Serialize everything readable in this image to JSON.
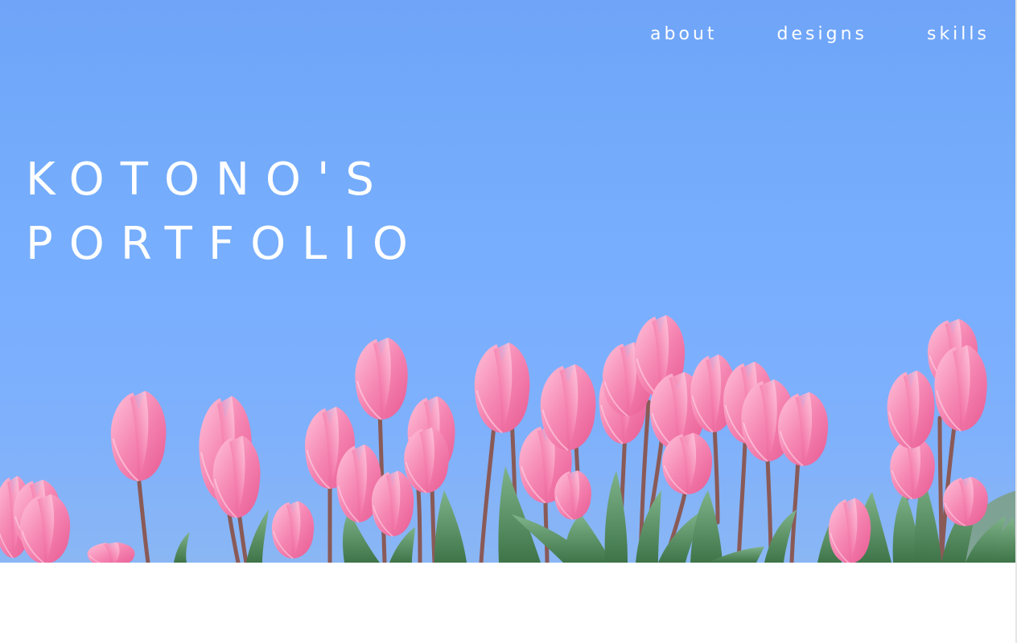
{
  "nav": {
    "items": [
      {
        "label": "about"
      },
      {
        "label": "designs"
      },
      {
        "label": "skills"
      }
    ]
  },
  "hero": {
    "title_line1": "KOTONO'S",
    "title_line2": "PORTFOLIO",
    "image": "pink-tulips-blue-sky"
  },
  "colors": {
    "sky_top": "#6fa4f8",
    "sky_mid": "#7aafff",
    "tulip_pink": "#f27aa8",
    "tulip_light": "#ffb6d0",
    "leaf_green": "#4f8a55",
    "stem": "#8a5a57",
    "text": "#ffffff"
  }
}
